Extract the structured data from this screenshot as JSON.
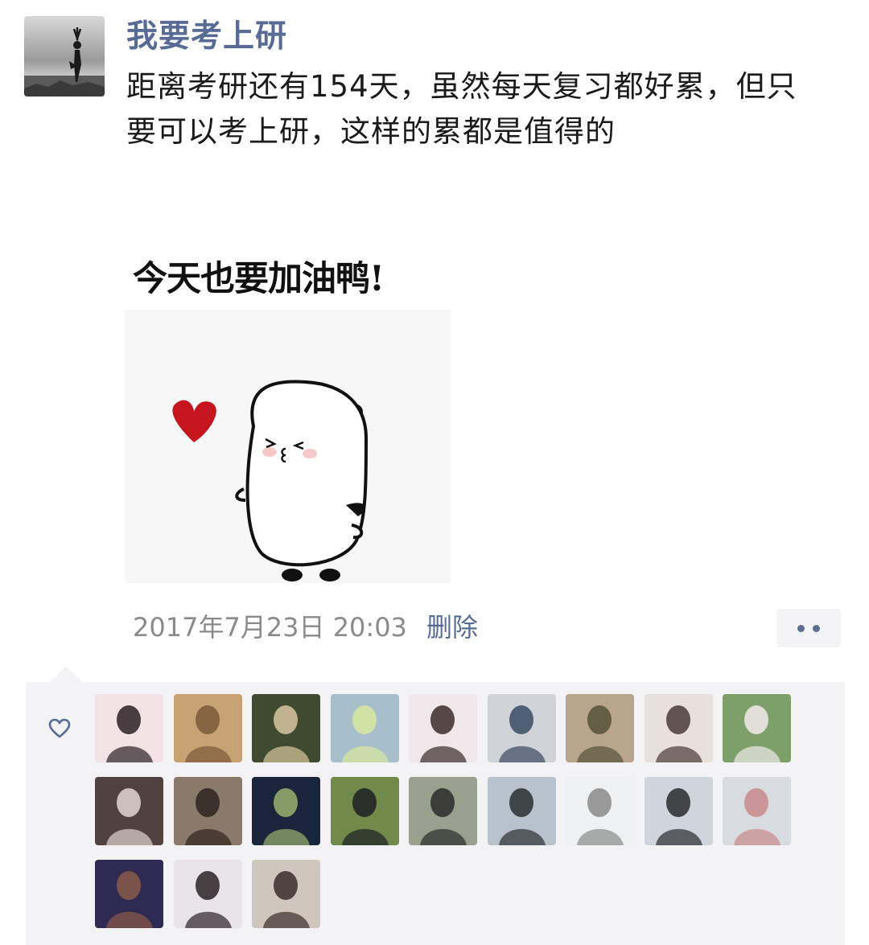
{
  "post": {
    "nickname": "我要考上研",
    "text": "距离考研还有154天，虽然每天复习都好累，但只要可以考上研，这样的累都是值得的",
    "image": {
      "caption": "今天也要加油鸭!"
    },
    "timestamp": "2017年7月23日 20:03",
    "delete_label": "删除",
    "more_icon": "more-dots-icon"
  },
  "likes": {
    "icon": "heart-outline-icon",
    "count": 21,
    "avatars": [
      {
        "bg": "#f2e2e6",
        "fg": "#2a2124"
      },
      {
        "bg": "#c7a273",
        "fg": "#7a5a3a"
      },
      {
        "bg": "#3f4a2e",
        "fg": "#d8c6a0"
      },
      {
        "bg": "#a7bfca",
        "fg": "#d8e8a0"
      },
      {
        "bg": "#efe7e9",
        "fg": "#3a2b2a"
      },
      {
        "bg": "#cfd3d8",
        "fg": "#3b4a63"
      },
      {
        "bg": "#b9a48c",
        "fg": "#55523a"
      },
      {
        "bg": "#e8e0da",
        "fg": "#4a3a35"
      },
      {
        "bg": "#7da06a",
        "fg": "#f1e9ea"
      },
      {
        "bg": "#50423e",
        "fg": "#e0d6d0"
      },
      {
        "bg": "#8a7a6a",
        "fg": "#2d2420"
      },
      {
        "bg": "#19253b",
        "fg": "#9ab070"
      },
      {
        "bg": "#6f8a4a",
        "fg": "#1e1e24"
      },
      {
        "bg": "#9aa08e",
        "fg": "#2b2b2b"
      },
      {
        "bg": "#b7c2cc",
        "fg": "#2a3030"
      },
      {
        "bg": "#eef0f2",
        "fg": "#8a8a8a"
      },
      {
        "bg": "#cfd5dc",
        "fg": "#2a2a2e"
      },
      {
        "bg": "#d8dbe0",
        "fg": "#c98a8a"
      },
      {
        "bg": "#2f2a52",
        "fg": "#8a5a4a"
      },
      {
        "bg": "#e9e4ea",
        "fg": "#2c2226"
      },
      {
        "bg": "#cfc6bd",
        "fg": "#3a2d2a"
      }
    ]
  }
}
